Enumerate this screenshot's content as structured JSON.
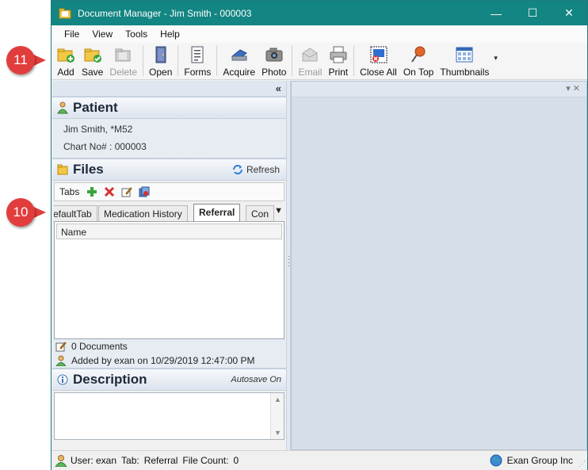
{
  "window": {
    "title": "Document Manager - Jim Smith - 000003",
    "minimize_glyph": "—",
    "maximize_glyph": "☐",
    "close_glyph": "✕"
  },
  "menu": [
    "File",
    "View",
    "Tools",
    "Help"
  ],
  "toolbar": {
    "add": "Add",
    "save": "Save",
    "delete": "Delete",
    "open": "Open",
    "forms": "Forms",
    "acquire": "Acquire",
    "photo": "Photo",
    "email": "Email",
    "print": "Print",
    "close_all": "Close All",
    "on_top": "On Top",
    "thumbnails": "Thumbnails"
  },
  "left_panel": {
    "collapse_glyph": "«",
    "patient": {
      "title": "Patient",
      "name_line": "Jim Smith, *M52",
      "chart_line": "Chart No# : 000003"
    },
    "files": {
      "title": "Files",
      "refresh": "Refresh",
      "tabs_label": "Tabs",
      "tabs": [
        "efaultTab",
        "Medication History",
        "Referral",
        "Con"
      ],
      "active_tab": "Referral",
      "column_header": "Name",
      "document_count": "0 Documents",
      "added_by": "Added by exan on 10/29/2019 12:47:00 PM"
    },
    "description": {
      "title": "Description",
      "autosave": "Autosave On"
    }
  },
  "statusbar": {
    "user": "User: exan",
    "tab": "Tab:",
    "tab_value": "Referral",
    "file_count": "File Count:",
    "file_count_value": "0",
    "company": "Exan Group Inc"
  },
  "callouts": {
    "toolbar": "11",
    "tabs": "10"
  },
  "colors": {
    "titlebar": "#138582",
    "callout": "#e23d3d",
    "panel_header": "#dde4ee",
    "viewer_bg": "#d6dfe9"
  }
}
